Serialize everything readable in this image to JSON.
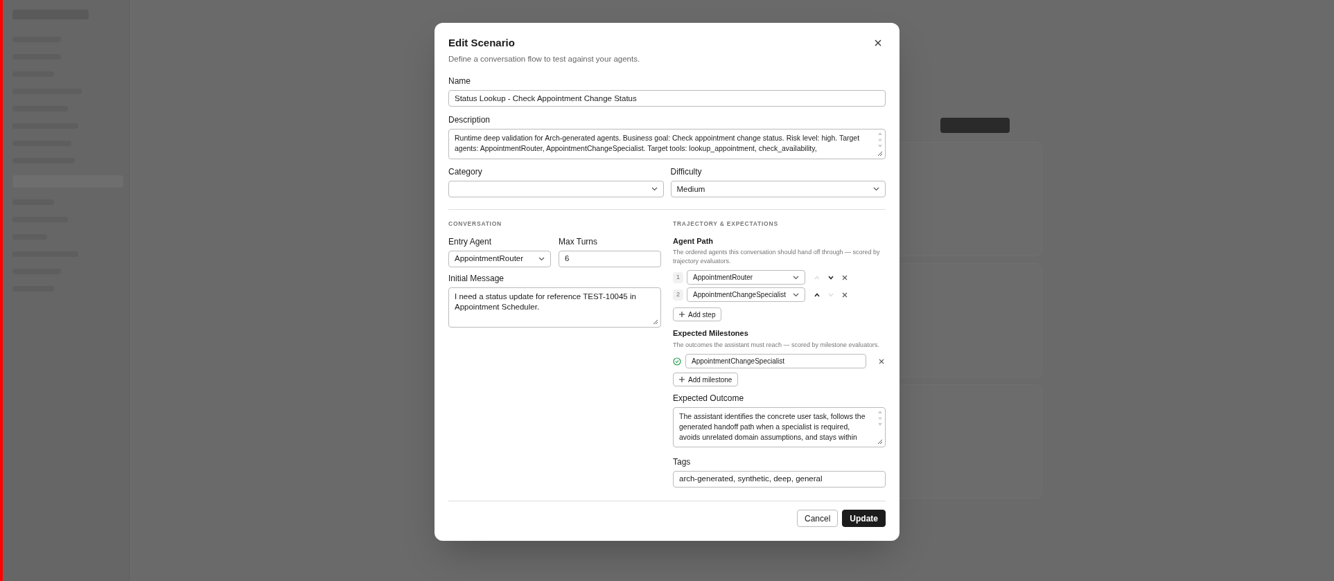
{
  "dialog": {
    "title": "Edit Scenario",
    "subtitle": "Define a conversation flow to test against your agents.",
    "name": {
      "label": "Name",
      "value": "Status Lookup - Check Appointment Change Status"
    },
    "description": {
      "label": "Description",
      "value": "Runtime deep validation for Arch-generated agents. Business goal: Check appointment change status. Risk level: high. Target agents: AppointmentRouter, AppointmentChangeSpecialist. Target tools: lookup_appointment, check_availability,"
    },
    "category": {
      "label": "Category"
    },
    "difficulty": {
      "label": "Difficulty",
      "value": "Medium"
    },
    "conversation": {
      "heading": "CONVERSATION",
      "entry_agent": {
        "label": "Entry Agent",
        "value": "AppointmentRouter"
      },
      "max_turns": {
        "label": "Max Turns",
        "value": "6"
      },
      "initial_message": {
        "label": "Initial Message",
        "value": "I need a status update for reference TEST-10045 in Appointment Scheduler."
      }
    },
    "trajectory": {
      "heading": "TRAJECTORY & EXPECTATIONS",
      "agent_path": {
        "label": "Agent Path",
        "description": "The ordered agents this conversation should hand off through — scored by trajectory evaluators.",
        "steps": [
          {
            "index": "1",
            "agent": "AppointmentRouter",
            "up_disabled": true,
            "down_disabled": false
          },
          {
            "index": "2",
            "agent": "AppointmentChangeSpecialist",
            "up_disabled": false,
            "down_disabled": true
          }
        ],
        "add_button": "Add step"
      },
      "milestones": {
        "label": "Expected Milestones",
        "description": "The outcomes the assistant must reach — scored by milestone evaluators.",
        "items": [
          {
            "value": "AppointmentChangeSpecialist"
          }
        ],
        "add_button": "Add milestone"
      },
      "expected_outcome": {
        "label": "Expected Outcome",
        "value": "The assistant identifies the concrete user task, follows the generated handoff path when a specialist is required, avoids unrelated domain assumptions, and stays within"
      },
      "tags": {
        "label": "Tags",
        "value": "arch-generated, synthetic, deep, general"
      }
    },
    "buttons": [
      {
        "label": "Cancel",
        "kind": "secondary"
      },
      {
        "label": "Update",
        "kind": "primary"
      }
    ]
  }
}
